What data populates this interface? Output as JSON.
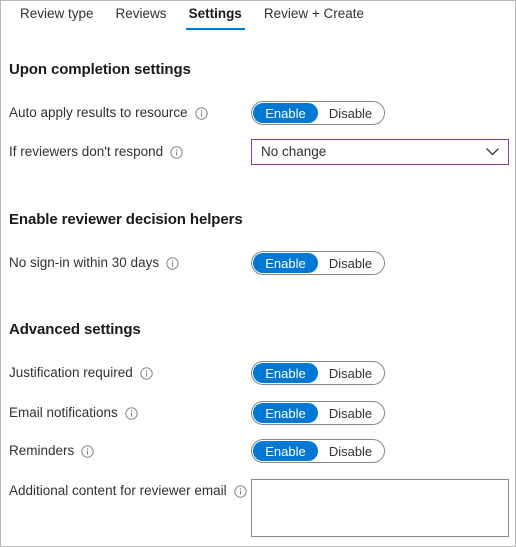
{
  "tabs": [
    {
      "label": "Review type",
      "selected": false
    },
    {
      "label": "Reviews",
      "selected": false
    },
    {
      "label": "Settings",
      "selected": true
    },
    {
      "label": "Review + Create",
      "selected": false
    }
  ],
  "sections": [
    {
      "title": "Upon completion settings"
    },
    {
      "title": "Enable reviewer decision helpers"
    },
    {
      "title": "Advanced settings"
    }
  ],
  "rows": {
    "auto_apply": {
      "label": "Auto apply results to resource",
      "info": "info-icon",
      "toggle": {
        "enable": "Enable",
        "disable": "Disable",
        "value": "Enable"
      }
    },
    "no_respond": {
      "label": "If reviewers don't respond",
      "info": "info-icon",
      "dropdown": {
        "value": "No change",
        "chevron": "chevron-down-icon"
      }
    },
    "no_signin": {
      "label": "No sign-in within 30 days",
      "info": "info-icon",
      "toggle": {
        "enable": "Enable",
        "disable": "Disable",
        "value": "Enable"
      }
    },
    "justification": {
      "label": "Justification required",
      "info": "info-icon",
      "toggle": {
        "enable": "Enable",
        "disable": "Disable",
        "value": "Enable"
      }
    },
    "email_notifications": {
      "label": "Email notifications",
      "info": "info-icon",
      "toggle": {
        "enable": "Enable",
        "disable": "Disable",
        "value": "Enable"
      }
    },
    "reminders": {
      "label": "Reminders",
      "info": "info-icon",
      "toggle": {
        "enable": "Enable",
        "disable": "Disable",
        "value": "Enable"
      }
    },
    "additional_content": {
      "label": "Additional content for reviewer email",
      "info": "info-icon",
      "textarea": {
        "value": "",
        "placeholder": ""
      }
    }
  },
  "colors": {
    "accent": "#0078d4",
    "focus_border": "#8e3fa8",
    "field_border": "#8a8886",
    "text": "#323130"
  }
}
